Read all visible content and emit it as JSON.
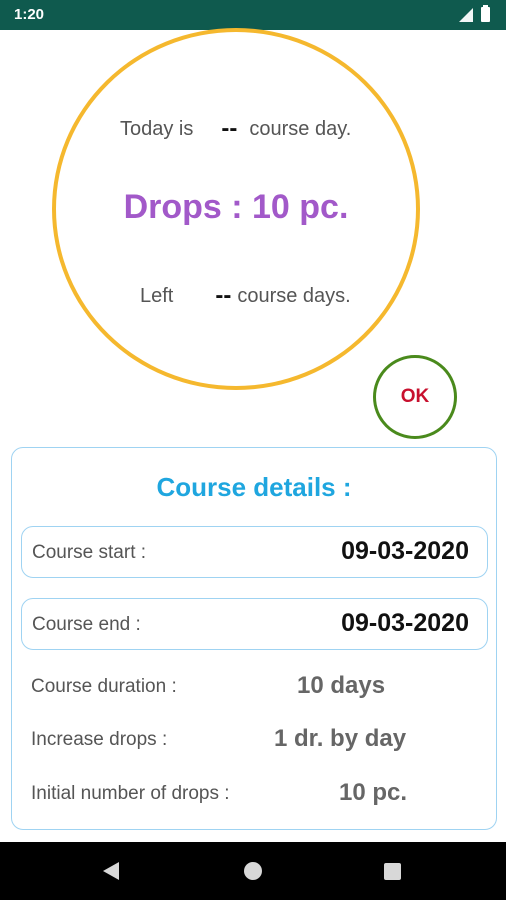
{
  "status_bar": {
    "time": "1:20",
    "icons": [
      "signal-icon",
      "battery-icon"
    ],
    "background_color": "#0f5a4e"
  },
  "counter": {
    "today_prefix": "Today is",
    "today_value": "--",
    "today_suffix": "course day.",
    "drops_text": "Drops : 10 pc.",
    "left_prefix": "Left",
    "left_value": "--",
    "left_suffix": "course days.",
    "ring_color": "#f5b82e",
    "drops_color": "#a259c9"
  },
  "ok_button": {
    "label": "OK",
    "border_color": "#4a8a1c",
    "text_color": "#c8102e"
  },
  "details": {
    "title": "Course details :",
    "title_color": "#1fa6df",
    "course_start_label": "Course start :",
    "course_start_value": "09-03-2020",
    "course_end_label": "Course end :",
    "course_end_value": "09-03-2020",
    "duration_label": "Course duration :",
    "duration_value": "10 days",
    "increase_label": "Increase drops :",
    "increase_value": "1 dr. by day",
    "initial_label": "Initial number of drops :",
    "initial_value": "10 pc."
  },
  "nav_bar": {
    "icons": [
      "back-icon",
      "home-icon",
      "recents-icon"
    ]
  }
}
